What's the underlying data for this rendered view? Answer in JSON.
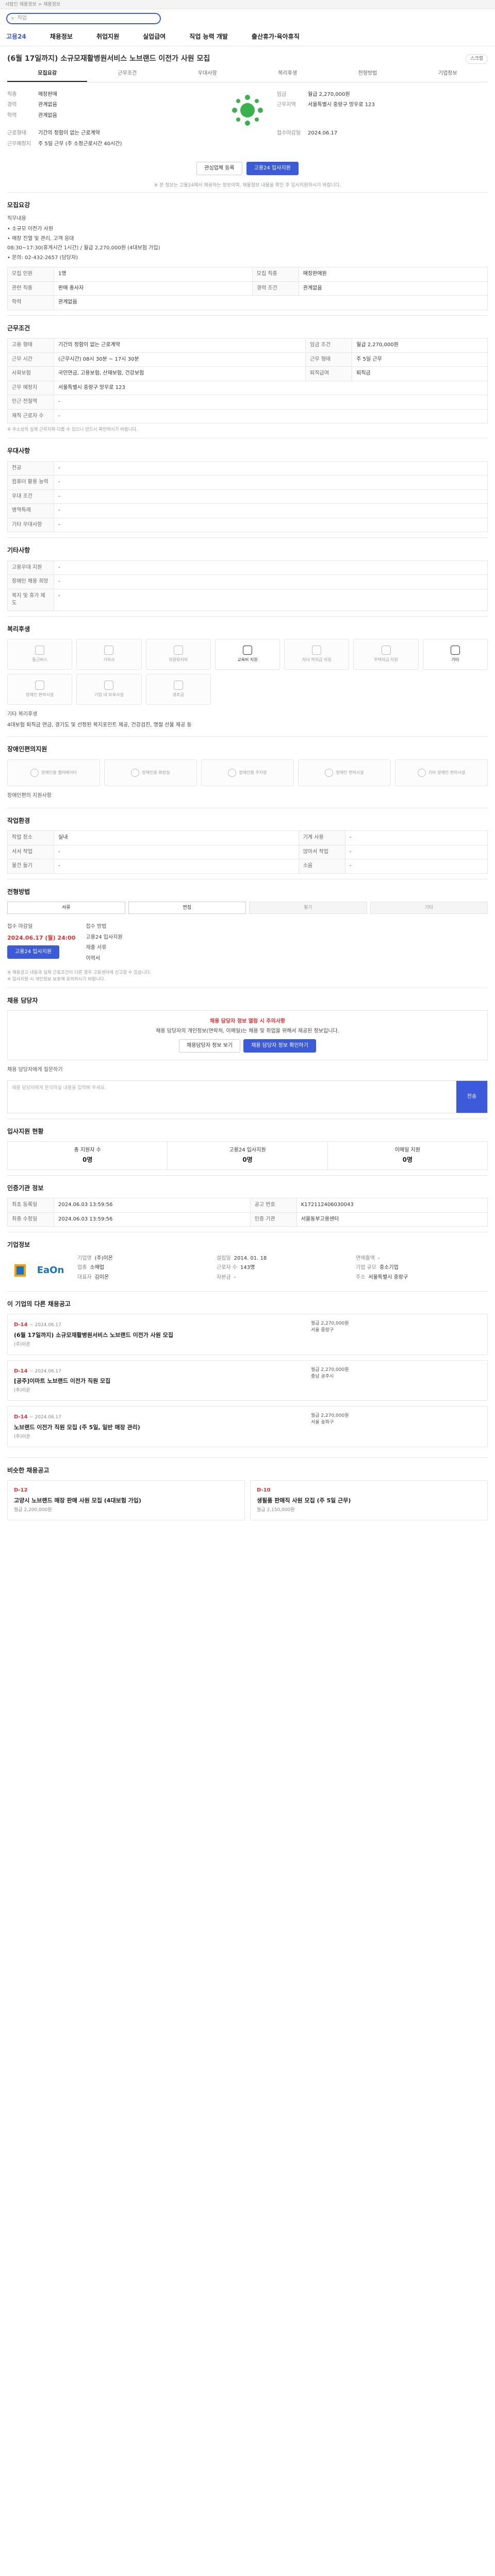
{
  "topbar": {
    "text": "사람인 채용정보 > 채용정보"
  },
  "search": {
    "placeholder": "직업",
    "icon": "search-icon"
  },
  "gnb": {
    "logo": "고용24",
    "items": [
      "채용정보",
      "취업지원",
      "실업급여",
      "직업 능력 개발",
      "출산휴가·육아휴직"
    ]
  },
  "job": {
    "title": "(6월 17일까지) 소규모재활병원서비스 노브랜드 이전가 사원 모집",
    "scrap": "스크랩"
  },
  "tabs": [
    "모집요강",
    "근무조건",
    "우대사항",
    "복리후생",
    "전형방법",
    "기업정보"
  ],
  "summary": {
    "left": [
      {
        "k": "직종",
        "v": "매장판매"
      },
      {
        "k": "경력",
        "v": "관계없음"
      },
      {
        "k": "학력",
        "v": "관계없음"
      }
    ],
    "left2": [
      {
        "k": "근로형태",
        "v": "기간의 정함이 없는 근로계약"
      },
      {
        "k": "근무예정지",
        "v": "주 5일 근무 (주 소정근로시간 40시간)"
      }
    ],
    "right": [
      {
        "k": "임금",
        "v": "월급 2,270,000원"
      },
      {
        "k": "근무지역",
        "v": "서울특별시 중랑구 망우로 123"
      }
    ],
    "right2": [
      {
        "k": "접수마감일",
        "v": "2024.06.17"
      }
    ],
    "company_logo_name": "EaOn"
  },
  "actions": {
    "interest": "관심업체 등록",
    "apply": "고용24 입사지원"
  },
  "summary_note": "※ 본 정보는 고용24에서 제공하는 정보이며, 채용정보 내용을 확인 후 입사지원하시기 바랍니다.",
  "recruit": {
    "title": "모집요강",
    "subtitle": "직무내용",
    "lines": [
      "• 소규모 이전가 사원",
      "• 매장 진열 및 관리, 고객 응대",
      "08:30~17:30(휴게시간 1시간) / 월급 2,270,000원 (4대보험 가입)",
      "• 문의: 02-432-2657 (담당자)"
    ],
    "rows": [
      {
        "k": "모집 인원",
        "v": "1명"
      },
      {
        "k": "모집 직종",
        "v": "매장판매원"
      },
      {
        "k": "관련 직종",
        "v": "판매 종사자"
      },
      {
        "k": "경력 조건",
        "v": "관계없음"
      },
      {
        "k": "학력",
        "v": "관계없음"
      }
    ]
  },
  "conditions": {
    "title": "근무조건",
    "rows": [
      {
        "k": "고용 형태",
        "v": "기간의 정함이 없는 근로계약"
      },
      {
        "k": "임금 조건",
        "v": "월급 2,270,000원"
      },
      {
        "k": "근무 시간",
        "v": "(근무시간) 08시 30분 ~ 17시 30분"
      },
      {
        "k": "근무 형태",
        "v": "주 5일 근무"
      },
      {
        "k": "사회보험",
        "v": "국민연금, 고용보험, 산재보험, 건강보험"
      },
      {
        "k": "퇴직급여",
        "v": "퇴직금"
      },
      {
        "k": "근무 예정지",
        "v": "서울특별시 중랑구 망우로 123"
      },
      {
        "k": "인근 전철역",
        "v": "-"
      },
      {
        "k": "재직 근로자 수",
        "v": "-"
      }
    ],
    "note": "※ 주소상의 실제 근무지와 다를 수 있으니 반드시 확인하시기 바랍니다."
  },
  "preference": {
    "title": "우대사항",
    "rows": [
      {
        "k": "전공",
        "v": "-"
      },
      {
        "k": "컴퓨터 활용 능력",
        "v": "-"
      },
      {
        "k": "우대 조건",
        "v": "-"
      },
      {
        "k": "병역특례",
        "v": "-"
      },
      {
        "k": "기타 우대사항",
        "v": "-"
      }
    ]
  },
  "other": {
    "title": "기타사항",
    "rows": [
      {
        "k": "고용우대 지원",
        "v": "-"
      },
      {
        "k": "장애인 채용 희망",
        "v": "-"
      },
      {
        "k": "복지 및 휴가 제도",
        "v": "-"
      }
    ]
  },
  "welfare": {
    "title": "복리후생",
    "items": [
      {
        "label": "통근버스",
        "on": false
      },
      {
        "label": "기숙사",
        "on": false
      },
      {
        "label": "차량유지비",
        "on": false
      },
      {
        "label": "교육비 지원",
        "on": true
      },
      {
        "label": "자녀 학자금 지원",
        "on": false
      },
      {
        "label": "주택자금 지원",
        "on": false
      },
      {
        "label": "기타",
        "on": true
      },
      {
        "label": "장애인 편의시설",
        "on": false
      },
      {
        "label": "기업 내 보육시설",
        "on": false
      },
      {
        "label": "경조금",
        "on": false
      }
    ],
    "sub": "기타 복리후생",
    "desc": "4대보험 퇴직금 연금, 경기도 및 선정된 복지포인트 제공, 건강검진, 명절 선물 제공 등"
  },
  "disability": {
    "title": "장애인편의지원",
    "items": [
      "장애인용 엘리베이터",
      "장애인용 화장실",
      "장애인용 주차장",
      "장애인 편의시설",
      "기타 장애인 편의시설"
    ],
    "sub": "장애인편의 지원사항"
  },
  "workenv": {
    "title": "작업환경",
    "rows": [
      {
        "k": "작업 장소",
        "v": "실내"
      },
      {
        "k": "기계 사용",
        "v": "-"
      },
      {
        "k": "서서 작업",
        "v": "-"
      },
      {
        "k": "앉아서 작업",
        "v": "-"
      },
      {
        "k": "물건 들기",
        "v": "-"
      },
      {
        "k": "소음",
        "v": "-"
      }
    ]
  },
  "selection": {
    "title": "전형방법",
    "methods": [
      {
        "label": "서류",
        "on": true
      },
      {
        "label": "면접",
        "on": true
      },
      {
        "label": "필기",
        "on": false
      },
      {
        "label": "기타",
        "on": false
      }
    ],
    "deadline_label": "접수 마감일",
    "deadline": "2024.06.17 (월) 24:00",
    "method_label": "접수 방법",
    "method_value": "고용24 입사지원",
    "docs_label": "제출 서류",
    "docs_value": "이력서",
    "apply_btn": "고용24 입사지원",
    "notes": [
      "※ 채용공고 내용과 실제 근로조건이 다른 경우 고용센터에 신고할 수 있습니다.",
      "※ 입사지원 시 개인정보 보호에 유의하시기 바랍니다."
    ]
  },
  "contact": {
    "title": "채용 담당자",
    "warn": "채용 담당자 정보 열람 시 주의사항",
    "desc": "채용 담당자의 개인정보(연락처, 이메일)는 채용 및 취업을 위해서 제공된 정보입니다.",
    "btn1": "채용담당자 정보 보기",
    "btn2": "채용 담당자 정보 확인하기",
    "ta_title": "채용 담당자에게 질문하기",
    "ta_placeholder": "채용 담당자에게 문의하실 내용을 입력해 주세요.",
    "send": "전송"
  },
  "apply_status": {
    "title": "입사지원 현황",
    "items": [
      {
        "k": "총 지원자 수",
        "v": "0명"
      },
      {
        "k": "고용24 입사지원",
        "v": "0명"
      },
      {
        "k": "이메일 지원",
        "v": "0명"
      }
    ]
  },
  "history": {
    "title": "인증기관 정보",
    "rows": [
      {
        "k": "최초 등록일",
        "v": "2024.06.03 13:59:56"
      },
      {
        "k": "최종 수정일",
        "v": "2024.06.03 13:59:56"
      },
      {
        "k": "공고 번호",
        "v": "K172112406030043"
      },
      {
        "k": "인증 기관",
        "v": "서울동부고용센터"
      }
    ]
  },
  "company": {
    "title": "기업정보",
    "logo": "EaOn",
    "fields": [
      {
        "k": "기업명",
        "v": "(주)이온"
      },
      {
        "k": "업종",
        "v": "소매업"
      },
      {
        "k": "대표자",
        "v": "김이온"
      },
      {
        "k": "설립일",
        "v": "2014. 01. 18"
      },
      {
        "k": "근로자 수",
        "v": "143명"
      },
      {
        "k": "자본금",
        "v": "-"
      },
      {
        "k": "연매출액",
        "v": "-"
      },
      {
        "k": "기업 규모",
        "v": "중소기업"
      },
      {
        "k": "주소",
        "v": "서울특별시 중랑구"
      }
    ]
  },
  "related": {
    "title": "이 기업의 다른 채용공고",
    "cards": [
      {
        "dday": "D-14",
        "date": "~ 2024.06.17",
        "title": "(6월 17일까지) 소규모재활병원서비스 노브랜드 이전가 사원 모집",
        "meta": "(주)이온",
        "wage": "월급 2,270,000원",
        "place": "서울 중랑구"
      },
      {
        "dday": "D-14",
        "date": "~ 2024.06.17",
        "title": "[공주]이마트 노브랜드 이전가 직원 모집",
        "meta": "(주)이온",
        "wage": "월급 2,270,000원",
        "place": "충남 공주시"
      },
      {
        "dday": "D-14",
        "date": "~ 2024.06.17",
        "title": "노브랜드 이전가 직원 모집 (주 5일, 일반 매장 관리)",
        "meta": "(주)이온",
        "wage": "월급 2,270,000원",
        "place": "서울 송파구"
      }
    ]
  },
  "similar": {
    "title": "비슷한 채용공고",
    "cards": [
      {
        "dday": "D-12",
        "title": "고양시 노브랜드 매장 판매 사원 모집 (4대보험 가입)",
        "meta": "월급 2,200,000원"
      },
      {
        "dday": "D-10",
        "title": "생필품 판매직 사원 모집 (주 5일 근무)",
        "meta": "월급 2,150,000원"
      }
    ]
  }
}
